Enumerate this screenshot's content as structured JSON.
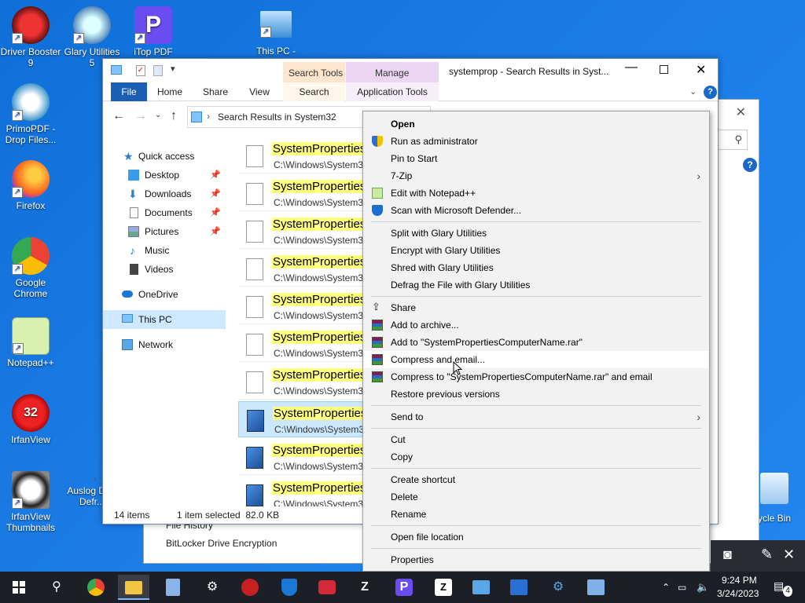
{
  "desktop": {
    "icons": [
      {
        "label": "Driver Booster 9"
      },
      {
        "label": "Glary Utilities 5"
      },
      {
        "label": "iTop PDF"
      },
      {
        "label": "This PC -"
      },
      {
        "label": "PrimoPDF - Drop Files..."
      },
      {
        "label": "Firefox"
      },
      {
        "label": "Google Chrome"
      },
      {
        "label": "Notepad++"
      },
      {
        "label": "IrfanView"
      },
      {
        "label": "IrfanView Thumbnails"
      },
      {
        "label": "Auslog Disk Defr..."
      },
      {
        "label": "ycle Bin"
      }
    ]
  },
  "background_window": {
    "items": [
      "File History",
      "BitLocker Drive Encryption"
    ]
  },
  "explorer": {
    "title": "systemprop - Search Results in Syst...",
    "tab_group_search": "Search Tools",
    "tab_group_manage": "Manage",
    "tabs": [
      "File",
      "Home",
      "Share",
      "View",
      "Search",
      "Application Tools"
    ],
    "address": "Search Results in System32",
    "nav": [
      {
        "label": "Quick access",
        "pinned": false
      },
      {
        "label": "Desktop",
        "pinned": true
      },
      {
        "label": "Downloads",
        "pinned": true
      },
      {
        "label": "Documents",
        "pinned": true
      },
      {
        "label": "Pictures",
        "pinned": true
      },
      {
        "label": "Music",
        "pinned": false
      },
      {
        "label": "Videos",
        "pinned": false
      },
      {
        "label": "OneDrive",
        "pinned": false
      },
      {
        "label": "This PC",
        "pinned": false
      },
      {
        "label": "Network",
        "pinned": false
      }
    ],
    "files": [
      {
        "name": "SystemProperties",
        "path": "C:\\Windows\\System3"
      },
      {
        "name": "SystemProperties",
        "path": "C:\\Windows\\System3"
      },
      {
        "name": "SystemProperties",
        "path": "C:\\Windows\\System3"
      },
      {
        "name": "SystemProperties",
        "path": "C:\\Windows\\System3"
      },
      {
        "name": "SystemProperties",
        "path": "C:\\Windows\\System3"
      },
      {
        "name": "SystemProperties",
        "path": "C:\\Windows\\System3"
      },
      {
        "name": "SystemProperties",
        "path": "C:\\Windows\\System3"
      },
      {
        "name": "SystemProperties",
        "path": "C:\\Windows\\System3"
      },
      {
        "name": "SystemProperties",
        "path": "C:\\Windows\\System3"
      },
      {
        "name": "SystemProperties",
        "path": "C:\\Windows\\System3"
      }
    ],
    "status_items": "14 items",
    "status_selected": "1 item selected  82.0 KB"
  },
  "context_menu": {
    "items": [
      "Open",
      "Run as administrator",
      "Pin to Start",
      "7-Zip",
      "Edit with Notepad++",
      "Scan with Microsoft Defender...",
      "Split with Glary Utilities",
      "Encrypt with Glary Utilities",
      "Shred with Glary Utilities",
      "Defrag the File with Glary Utilities",
      "Share",
      "Add to archive...",
      "Add to \"SystemPropertiesComputerName.rar\"",
      "Compress and email...",
      "Compress to \"SystemPropertiesComputerName.rar\" and email",
      "Restore previous versions",
      "Send to",
      "Cut",
      "Copy",
      "Create shortcut",
      "Delete",
      "Rename",
      "Open file location",
      "Properties"
    ]
  },
  "taskbar": {
    "time": "9:24 PM",
    "date": "3/24/2023",
    "notification_count": "4"
  }
}
